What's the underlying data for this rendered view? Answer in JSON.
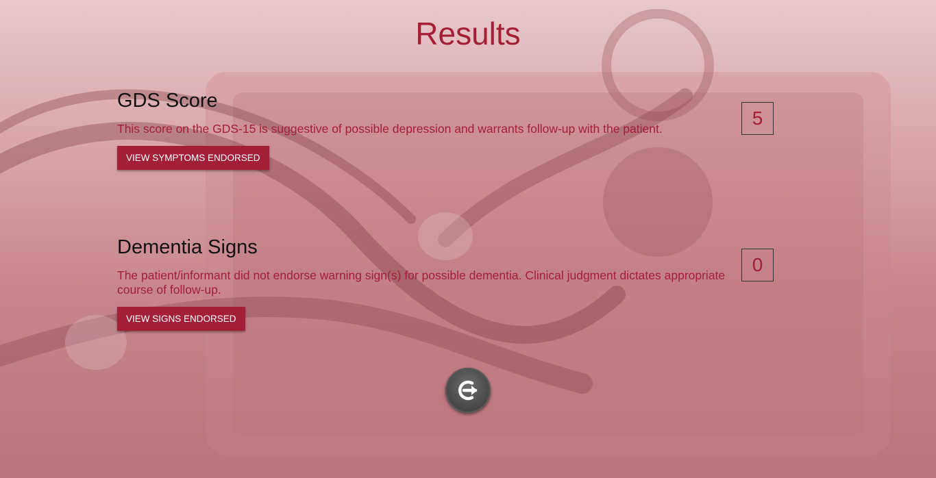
{
  "page": {
    "title": "Results"
  },
  "gds": {
    "heading": "GDS Score",
    "description": "This score on the GDS-15 is suggestive of possible depression and warrants follow-up with the patient.",
    "button_label": "VIEW SYMPTOMS ENDORSED",
    "score": "5"
  },
  "dementia": {
    "heading": "Dementia Signs",
    "description": "The patient/informant did not endorse warning sign(s) for possible dementia. Clinical judgment dictates appropriate course of follow-up.",
    "button_label": "VIEW SIGNS ENDORSED",
    "score": "0"
  },
  "logout": {
    "icon": "logout-arrow-icon"
  },
  "colors": {
    "accent": "#a31f37",
    "button_text": "#ffffff",
    "logout_bg": "#4a4a4a"
  }
}
